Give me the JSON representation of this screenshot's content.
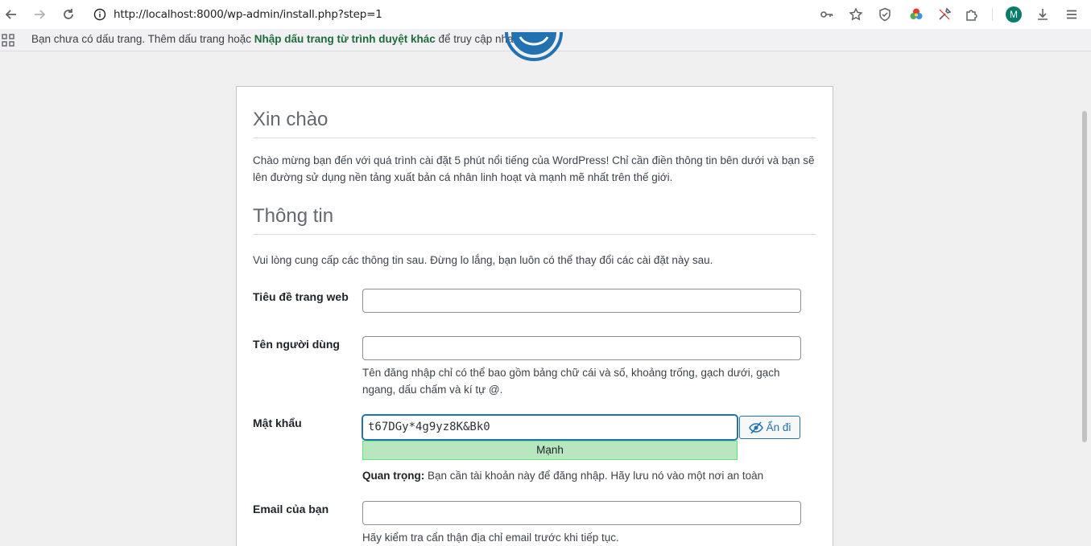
{
  "browser": {
    "url": "http://localhost:8000/wp-admin/install.php?step=1",
    "profile_initial": "M",
    "bookmarks_bar": {
      "text_before": "Bạn chưa có dấu trang. Thêm dấu trang hoặc ",
      "link": "Nhập dấu trang từ trình duyệt khác",
      "text_after": " để truy cập nhanh hơn."
    }
  },
  "page": {
    "heading_welcome": "Xin chào",
    "welcome_text": "Chào mừng bạn đến với quá trình cài đặt 5 phút nổi tiếng của WordPress! Chỉ cần điền thông tin bên dưới và bạn sẽ lên đường sử dụng nền tảng xuất bản cá nhân linh hoạt và mạnh mẽ nhất trên thế giới.",
    "heading_info": "Thông tin",
    "info_text": "Vui lòng cung cấp các thông tin sau. Đừng lo lắng, bạn luôn có thể thay đổi các cài đặt này sau.",
    "fields": {
      "site_title": {
        "label": "Tiêu đề trang web",
        "value": ""
      },
      "username": {
        "label": "Tên người dùng",
        "value": "",
        "hint": "Tên đăng nhập chỉ có thể bao gồm bảng chữ cái và số, khoảng trống, gạch dưới, gạch ngang, dấu chấm và kí tự @."
      },
      "password": {
        "label": "Mật khẩu",
        "value": "t67DGy*4g9yz8K&Bk0",
        "strength": "Mạnh",
        "hide_label": "Ẩn đi",
        "important_bold": "Quan trọng:",
        "important_text": " Bạn cần tài khoản này để đăng nhập. Hãy lưu nó vào một nơi an toàn"
      },
      "email": {
        "label": "Email của bạn",
        "value": "",
        "hint": "Hãy kiểm tra cẩn thận địa chỉ email trước khi tiếp tục."
      }
    }
  },
  "colors": {
    "accent": "#2271b1",
    "strong": "#b8e6bf",
    "link_green": "#1e6b3a"
  }
}
